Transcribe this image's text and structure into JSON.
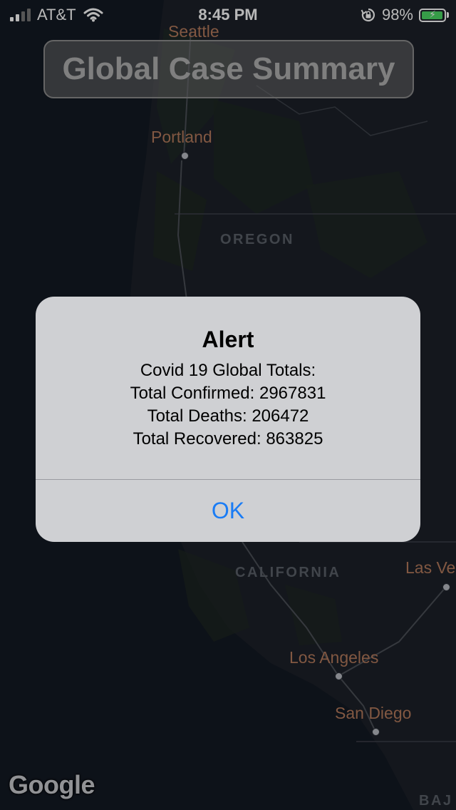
{
  "status_bar": {
    "carrier": "AT&T",
    "time": "8:45 PM",
    "battery_percent": "98%",
    "battery_level": 0.98,
    "icons": [
      "signal-icon",
      "wifi-icon",
      "rotation-lock-icon",
      "battery-charging-icon"
    ]
  },
  "title_button": {
    "label": "Global Case Summary"
  },
  "map": {
    "labels": {
      "seattle": "Seattle",
      "portland": "Portland",
      "oregon": "OREGON",
      "california": "CALIFORNIA",
      "las_vegas": "Las Ve",
      "los_angeles": "Los Angeles",
      "san_diego": "San Diego",
      "baja": "BAJ"
    },
    "attribution": "Google"
  },
  "alert": {
    "title": "Alert",
    "lines": [
      "Covid 19 Global Totals:",
      "Total Confirmed: 2967831",
      "Total Deaths: 206472",
      "Total Recovered: 863825"
    ],
    "ok_label": "OK",
    "colors": {
      "ok": "#1a7cf5",
      "background": "#cfd0d3"
    }
  }
}
